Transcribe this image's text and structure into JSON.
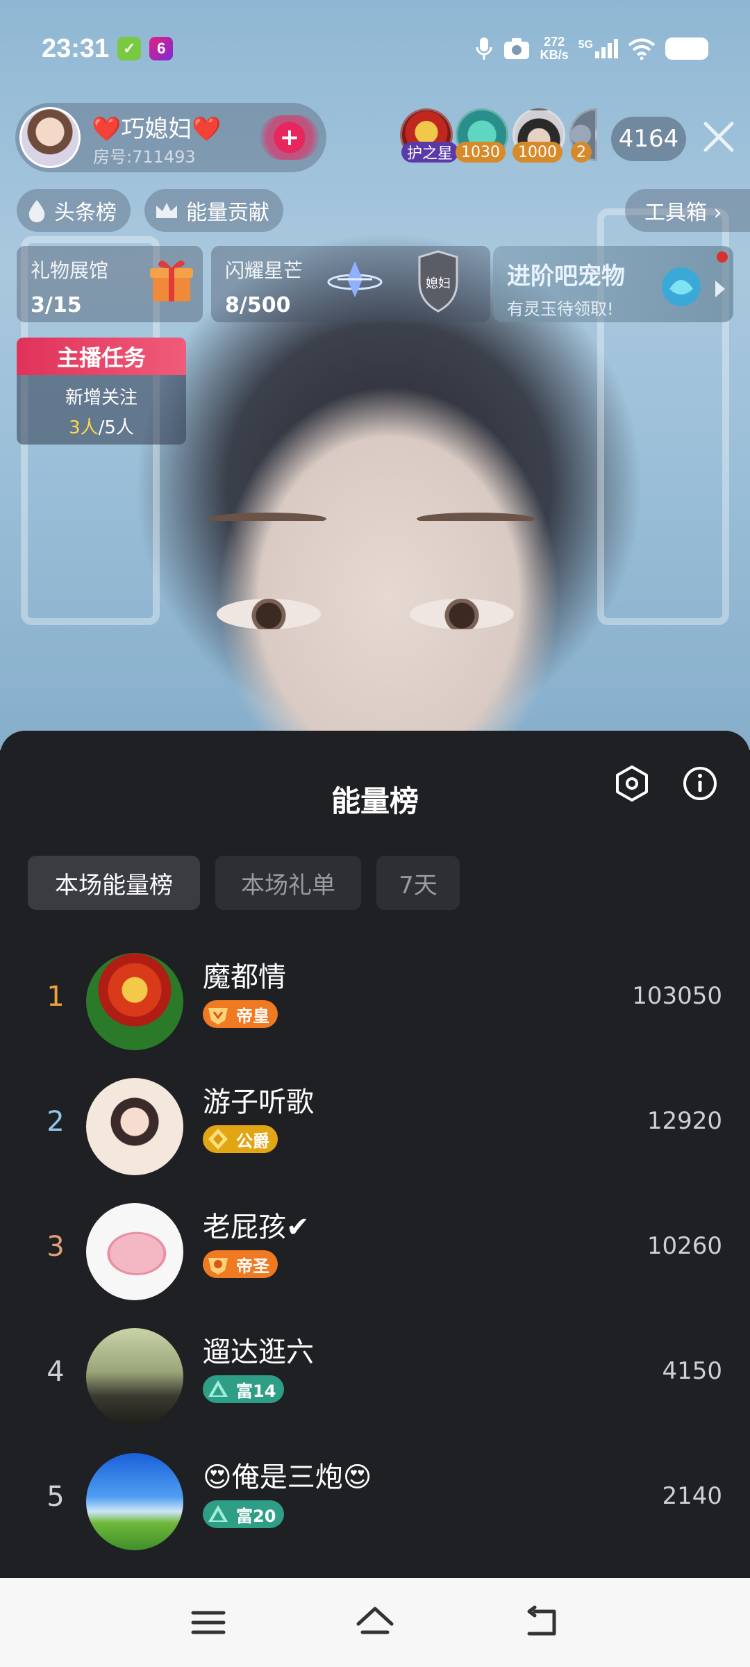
{
  "status_bar": {
    "time": "23:31",
    "net_speed": "272",
    "net_unit": "KB/s",
    "signal_label": "5G"
  },
  "room": {
    "host_name": "❤️巧媳妇❤️",
    "room_id": "房号:711493",
    "viewer_badges": [
      "护之星",
      "1030",
      "1000",
      "2"
    ],
    "viewer_count": "4164"
  },
  "chips": {
    "headline": "头条榜",
    "energy": "能量贡献",
    "toolbox": "工具箱 ›"
  },
  "cards": {
    "gift_hall": {
      "title": "礼物展馆",
      "value": "3/15"
    },
    "shine": {
      "title": "闪耀星芒",
      "value": "8/500"
    },
    "shield_text": "媳妇"
  },
  "promo": {
    "title": "进阶吧宠物",
    "subtitle": "有灵玉待领取!"
  },
  "task": {
    "title": "主播任务",
    "line1": "新增关注",
    "current": "3人",
    "target": "/5人"
  },
  "sheet": {
    "title": "能量榜",
    "tabs": [
      "本场能量榜",
      "本场礼单",
      "7天"
    ]
  },
  "ranking": [
    {
      "rank": "1",
      "name": "魔都情",
      "level": "帝皇",
      "score": "103050",
      "rank_color": "#f0a13a",
      "badge_color": "#f07a22"
    },
    {
      "rank": "2",
      "name": "游子听歌",
      "level": "公爵",
      "score": "12920",
      "rank_color": "#8fc7e8",
      "badge_color": "#e2a614"
    },
    {
      "rank": "3",
      "name": "老屁孩✔",
      "level": "帝圣",
      "score": "10260",
      "rank_color": "#e0a07a",
      "badge_color": "#f07a22"
    },
    {
      "rank": "4",
      "name": "遛达逛六",
      "level": "富14",
      "score": "4150",
      "rank_color": "#d0d0d4",
      "badge_color": "#2f9e86"
    },
    {
      "rank": "5",
      "name": "😍俺是三炮😍",
      "level": "富20",
      "score": "2140",
      "rank_color": "#d0d0d4",
      "badge_color": "#2f9e86"
    }
  ]
}
